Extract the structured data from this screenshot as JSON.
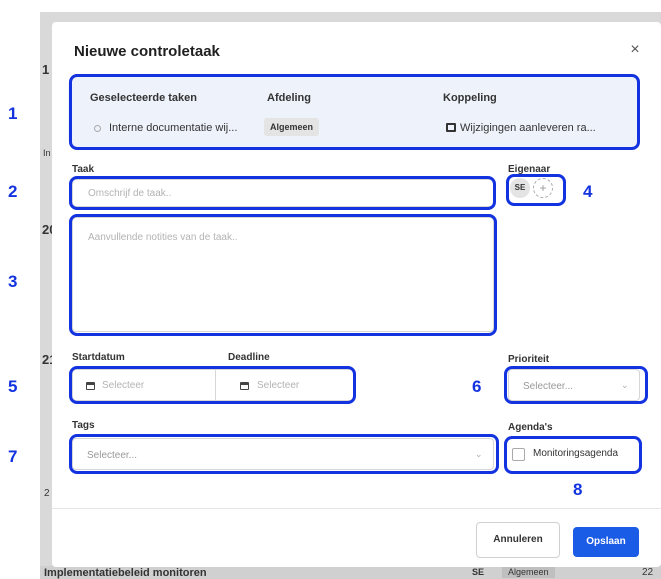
{
  "modal": {
    "title": "Nieuwe controletaak",
    "close_glyph": "×",
    "info": {
      "selected_tasks_label": "Geselecteerde taken",
      "selected_task_value": "Interne documentatie wij...",
      "department_label": "Afdeling",
      "department_value": "Algemeen",
      "link_label": "Koppeling",
      "link_value": "Wijzigingen aanleveren ra..."
    },
    "task": {
      "label": "Taak",
      "placeholder": "Omschrijf de taak.."
    },
    "notes": {
      "placeholder": "Aanvullende notities van de taak.."
    },
    "owner": {
      "label": "Eigenaar",
      "initials": "SE",
      "add_glyph": "+"
    },
    "start_date": {
      "label": "Startdatum",
      "placeholder": "Selecteer"
    },
    "deadline": {
      "label": "Deadline",
      "placeholder": "Selecteer"
    },
    "priority": {
      "label": "Prioriteit",
      "placeholder": "Selecteer..."
    },
    "tags": {
      "label": "Tags",
      "placeholder": "Selecteer..."
    },
    "agendas": {
      "label": "Agenda's",
      "option": "Monitoringsagenda"
    },
    "buttons": {
      "cancel": "Annuleren",
      "save": "Opslaan"
    }
  },
  "background": {
    "footer_row_text": "Implementatiebeleid monitoren",
    "footer_initials": "SE",
    "footer_chip": "Algemeen",
    "footer_number": "22",
    "left_edge_fragments": [
      "1",
      "In",
      "20",
      "21",
      "2"
    ]
  },
  "annotations": [
    "1",
    "2",
    "3",
    "4",
    "5",
    "6",
    "7",
    "8"
  ],
  "colors": {
    "accent": "#1a5ce5",
    "annotation": "#1433e0",
    "info_panel": "#eef3fb"
  }
}
